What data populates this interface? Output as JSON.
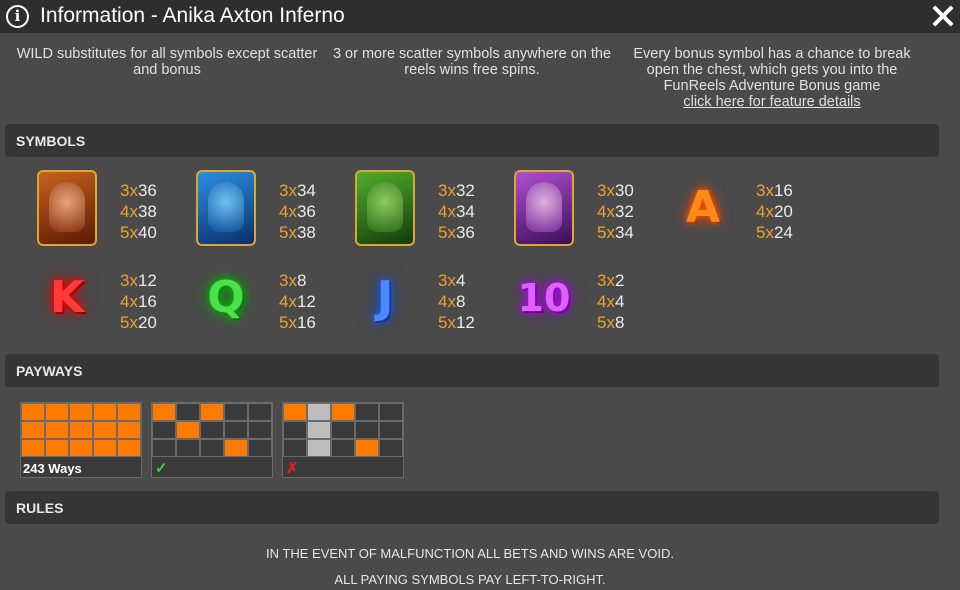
{
  "header": {
    "title": "Information - Anika Axton Inferno",
    "info_glyph": "i"
  },
  "features": [
    {
      "text": "WILD substitutes for all symbols except scatter and bonus"
    },
    {
      "text": "3 or more scatter symbols anywhere on the reels wins free spins."
    },
    {
      "text": "Every bonus symbol has a chance to break open the chest, which gets you into the FunReels Adventure Bonus game",
      "link": "click here for feature details"
    }
  ],
  "sections": {
    "symbols": "SYMBOLS",
    "payways": "PAYWAYS",
    "rules": "RULES"
  },
  "symbols": [
    {
      "name": "anika-portrait",
      "pays": [
        [
          "3x",
          "36"
        ],
        [
          "4x",
          "38"
        ],
        [
          "5x",
          "40"
        ]
      ]
    },
    {
      "name": "blue-demon",
      "pays": [
        [
          "3x",
          "34"
        ],
        [
          "4x",
          "36"
        ],
        [
          "5x",
          "38"
        ]
      ]
    },
    {
      "name": "green-orc",
      "pays": [
        [
          "3x",
          "32"
        ],
        [
          "4x",
          "34"
        ],
        [
          "5x",
          "36"
        ]
      ]
    },
    {
      "name": "purple-sorceress",
      "pays": [
        [
          "3x",
          "30"
        ],
        [
          "4x",
          "32"
        ],
        [
          "5x",
          "34"
        ]
      ]
    },
    {
      "name": "a",
      "glyph": "A",
      "pays": [
        [
          "3x",
          "16"
        ],
        [
          "4x",
          "20"
        ],
        [
          "5x",
          "24"
        ]
      ]
    },
    {
      "name": "k",
      "glyph": "K",
      "pays": [
        [
          "3x",
          "12"
        ],
        [
          "4x",
          "16"
        ],
        [
          "5x",
          "20"
        ]
      ]
    },
    {
      "name": "q",
      "glyph": "Q",
      "pays": [
        [
          "3x",
          "8"
        ],
        [
          "4x",
          "12"
        ],
        [
          "5x",
          "16"
        ]
      ]
    },
    {
      "name": "j",
      "glyph": "J",
      "pays": [
        [
          "3x",
          "4"
        ],
        [
          "4x",
          "8"
        ],
        [
          "5x",
          "12"
        ]
      ]
    },
    {
      "name": "10",
      "glyph": "10",
      "pays": [
        [
          "3x",
          "2"
        ],
        [
          "4x",
          "4"
        ],
        [
          "5x",
          "8"
        ]
      ]
    }
  ],
  "payways": {
    "ways_label": "243 Ways",
    "valid_mark": "✓",
    "invalid_mark": "✗"
  },
  "rules": [
    "IN THE EVENT OF MALFUNCTION ALL BETS AND WINS ARE VOID.",
    "ALL PAYING SYMBOLS PAY LEFT-TO-RIGHT."
  ],
  "colors": {
    "accent": "#ff7a00",
    "multiplier": "#f0a030",
    "valid": "#35d53a",
    "invalid": "#e52020"
  }
}
